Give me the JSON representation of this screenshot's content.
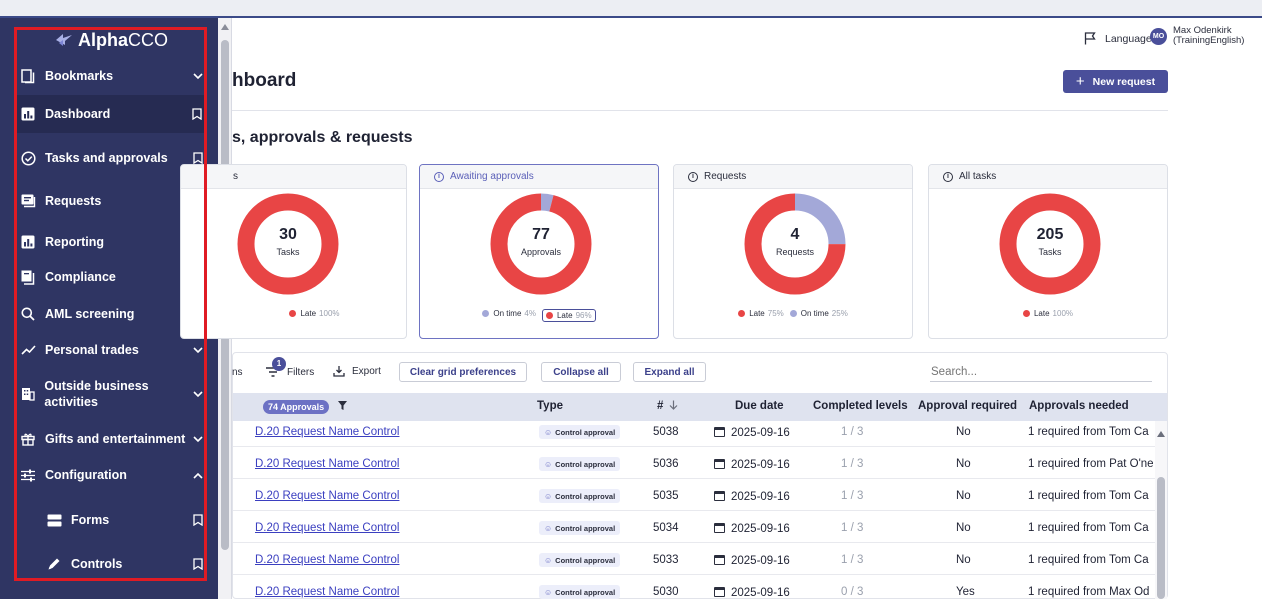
{
  "app": {
    "logo_strong": "Alpha",
    "logo_light": "CCO"
  },
  "sidebar": {
    "items": [
      {
        "label": "Bookmarks",
        "icon": "bookmarks-icon",
        "trail": "chevron-down-icon"
      },
      {
        "label": "Dashboard",
        "icon": "chart-icon",
        "trail": "bookmark-icon",
        "active": true
      },
      {
        "label": "Tasks and approvals",
        "icon": "check-circle-icon",
        "trail": "bookmark-icon"
      },
      {
        "label": "Requests",
        "icon": "requests-icon",
        "trail": "bookmark-icon"
      },
      {
        "label": "Reporting",
        "icon": "chart-icon",
        "trail": "chevron-down-icon"
      },
      {
        "label": "Compliance",
        "icon": "compliance-icon",
        "trail": "chevron-down-icon"
      },
      {
        "label": "AML screening",
        "icon": "search-icon",
        "trail": "chevron-down-icon"
      },
      {
        "label": "Personal trades",
        "icon": "trend-icon",
        "trail": "chevron-down-icon"
      },
      {
        "label": "Outside business activities",
        "icon": "building-icon",
        "trail": "chevron-down-icon"
      },
      {
        "label": "Gifts and entertainment",
        "icon": "gift-icon",
        "trail": "chevron-down-icon"
      },
      {
        "label": "Configuration",
        "icon": "sliders-icon",
        "trail": "chevron-up-icon"
      },
      {
        "label": "Forms",
        "icon": "forms-icon",
        "trail": "bookmark-icon"
      },
      {
        "label": "Controls",
        "icon": "pencil-icon",
        "trail": "bookmark-icon"
      }
    ]
  },
  "header": {
    "language": "Language",
    "user_initials": "MO",
    "user_name": "Max Odenkirk",
    "user_org": "(TrainingEnglish)"
  },
  "page": {
    "title": "hboard",
    "new_request": "New request",
    "section_title": "s, approvals & requests"
  },
  "cards": [
    {
      "header": "s",
      "value": "30",
      "unit": "Tasks",
      "legend": [
        {
          "label": "Late",
          "pct": "100%",
          "color": "#e84545"
        }
      ]
    },
    {
      "header": "Awaiting approvals",
      "value": "77",
      "unit": "Approvals",
      "legend": [
        {
          "label": "On time",
          "pct": "4%",
          "color": "#a3a8d8"
        },
        {
          "label": "Late",
          "pct": "96%",
          "color": "#e84545"
        }
      ]
    },
    {
      "header": "Requests",
      "value": "4",
      "unit": "Requests",
      "legend": [
        {
          "label": "Late",
          "pct": "75%",
          "color": "#e84545"
        },
        {
          "label": "On time",
          "pct": "25%",
          "color": "#a3a8d8"
        }
      ]
    },
    {
      "header": "All tasks",
      "value": "205",
      "unit": "Tasks",
      "legend": [
        {
          "label": "Late",
          "pct": "100%",
          "color": "#e84545"
        }
      ]
    }
  ],
  "colors": {
    "late": "#e84545",
    "on_time": "#a3a8d8",
    "accent": "#4a4f9a",
    "sidebar": "#2f3563"
  },
  "toolbar": {
    "columns_partial": "ns",
    "filters": "Filters",
    "filter_count": "1",
    "export": "Export",
    "clear": "Clear grid preferences",
    "collapse": "Collapse all",
    "expand": "Expand all",
    "search_placeholder": "Search..."
  },
  "table": {
    "chip": "74 Approvals",
    "headers": {
      "type": "Type",
      "number": "#",
      "sort_icon": "arrow-down-icon",
      "due": "Due date",
      "completed": "Completed levels",
      "approval_required": "Approval required",
      "approvals_needed": "Approvals needed"
    },
    "rows": [
      {
        "name": "D.20 Request Name Control",
        "type": "Control approval",
        "number": "5038",
        "due": "2025-09-16",
        "completed": "1 / 3",
        "required": "No",
        "needed": "1 required from Tom Ca"
      },
      {
        "name": "D.20 Request Name Control",
        "type": "Control approval",
        "number": "5036",
        "due": "2025-09-16",
        "completed": "1 / 3",
        "required": "No",
        "needed": "1 required from Pat O'ne"
      },
      {
        "name": "D.20 Request Name Control",
        "type": "Control approval",
        "number": "5035",
        "due": "2025-09-16",
        "completed": "1 / 3",
        "required": "No",
        "needed": "1 required from Tom Ca"
      },
      {
        "name": "D.20 Request Name Control",
        "type": "Control approval",
        "number": "5034",
        "due": "2025-09-16",
        "completed": "1 / 3",
        "required": "No",
        "needed": "1 required from Tom Ca"
      },
      {
        "name": "D.20 Request Name Control",
        "type": "Control approval",
        "number": "5033",
        "due": "2025-09-16",
        "completed": "1 / 3",
        "required": "No",
        "needed": "1 required from Tom Ca"
      },
      {
        "name": "D.20 Request Name Control",
        "type": "Control approval",
        "number": "5030",
        "due": "2025-09-16",
        "completed": "0 / 3",
        "required": "Yes",
        "needed": "1 required from Max Od"
      }
    ]
  }
}
